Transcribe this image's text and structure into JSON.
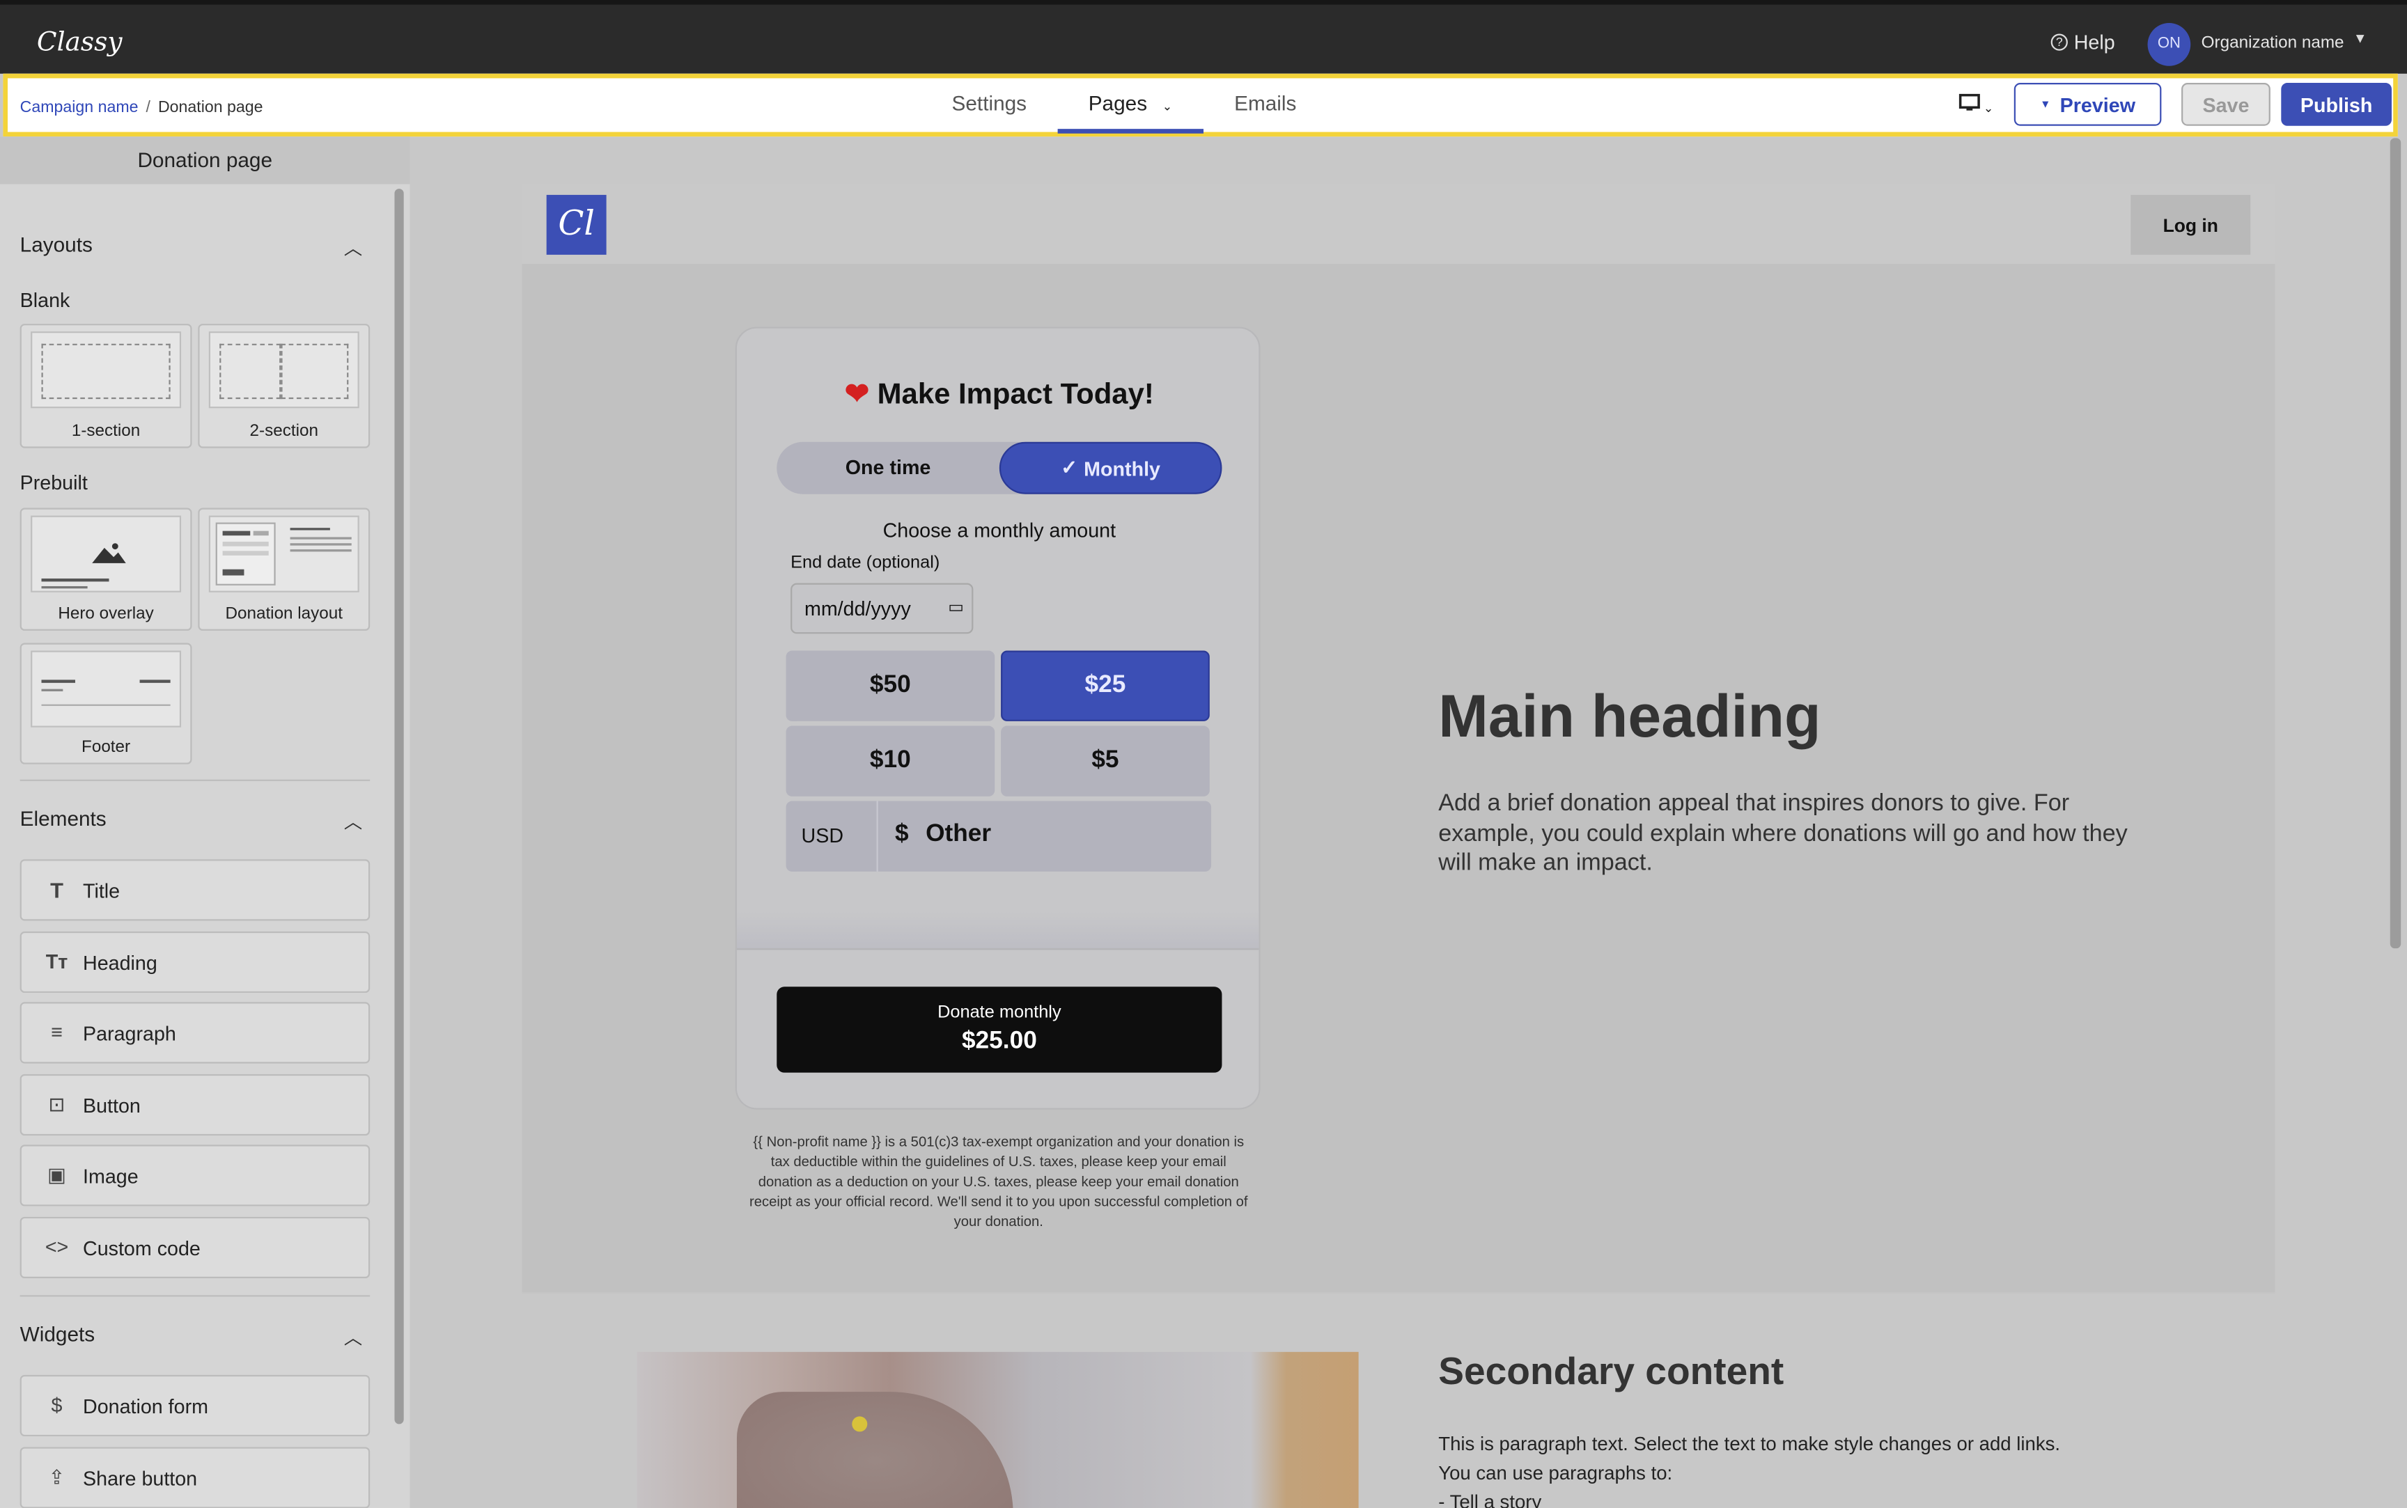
{
  "topbar": {
    "logo": "Classy",
    "help_label": "Help",
    "avatar_initials": "ON",
    "org_name": "Organization name"
  },
  "navbar": {
    "breadcrumb": {
      "campaign": "Campaign name",
      "separator": "/",
      "page": "Donation page"
    },
    "tabs": [
      {
        "label": "Settings",
        "active": false
      },
      {
        "label": "Pages",
        "active": true,
        "has_dropdown": true
      },
      {
        "label": "Emails",
        "active": false
      }
    ],
    "device_icon": "desktop-icon",
    "preview_label": "Preview",
    "save_label": "Save",
    "publish_label": "Publish",
    "accent_color": "#3c4fb5",
    "highlight_color": "#f3d33a"
  },
  "sidebar": {
    "title": "Donation page",
    "layouts": {
      "label": "Layouts",
      "blank_label": "Blank",
      "blank": [
        {
          "label": "1-section"
        },
        {
          "label": "2-section"
        }
      ],
      "prebuilt_label": "Prebuilt",
      "prebuilt": [
        {
          "label": "Hero overlay"
        },
        {
          "label": "Donation layout"
        },
        {
          "label": "Footer"
        }
      ]
    },
    "elements": {
      "label": "Elements",
      "items": [
        {
          "label": "Title",
          "icon": "title-icon"
        },
        {
          "label": "Heading",
          "icon": "heading-icon"
        },
        {
          "label": "Paragraph",
          "icon": "paragraph-icon"
        },
        {
          "label": "Button",
          "icon": "button-icon"
        },
        {
          "label": "Image",
          "icon": "image-icon"
        },
        {
          "label": "Custom code",
          "icon": "code-icon"
        }
      ]
    },
    "widgets": {
      "label": "Widgets",
      "items": [
        {
          "label": "Donation form",
          "icon": "dollar-icon"
        },
        {
          "label": "Share button",
          "icon": "share-icon"
        }
      ]
    }
  },
  "site": {
    "logo": "Cl",
    "login_label": "Log in",
    "form": {
      "title": "Make Impact Today!",
      "freq_one": "One time",
      "freq_monthly": "Monthly",
      "choose_label": "Choose a monthly amount",
      "end_date_label": "End date (optional)",
      "date_placeholder": "mm/dd/yyyy",
      "amounts": [
        "$50",
        "$25",
        "$10",
        "$5"
      ],
      "selected_amount": "$25",
      "currency": "USD",
      "currency_symbol": "$",
      "other_placeholder": "Other",
      "donate_line1": "Donate monthly",
      "donate_amount": "$25.00"
    },
    "legal": "{{ Non-profit name }} is a 501(c)3 tax-exempt organization and your donation is tax deductible within the guidelines of U.S. taxes, please keep your email donation as a deduction on your U.S. taxes, please keep your email donation receipt as your official record. We'll send it to you upon successful completion of your donation.",
    "main_heading": "Main heading",
    "main_paragraph": "Add a brief donation appeal that inspires donors to give. For example, you could explain where donations will go and how they will make an impact.",
    "secondary_heading": "Secondary content",
    "secondary_lines": [
      "This is paragraph text. Select the text to make style changes or add links.",
      "You can use paragraphs to:",
      "- Tell a story"
    ]
  }
}
